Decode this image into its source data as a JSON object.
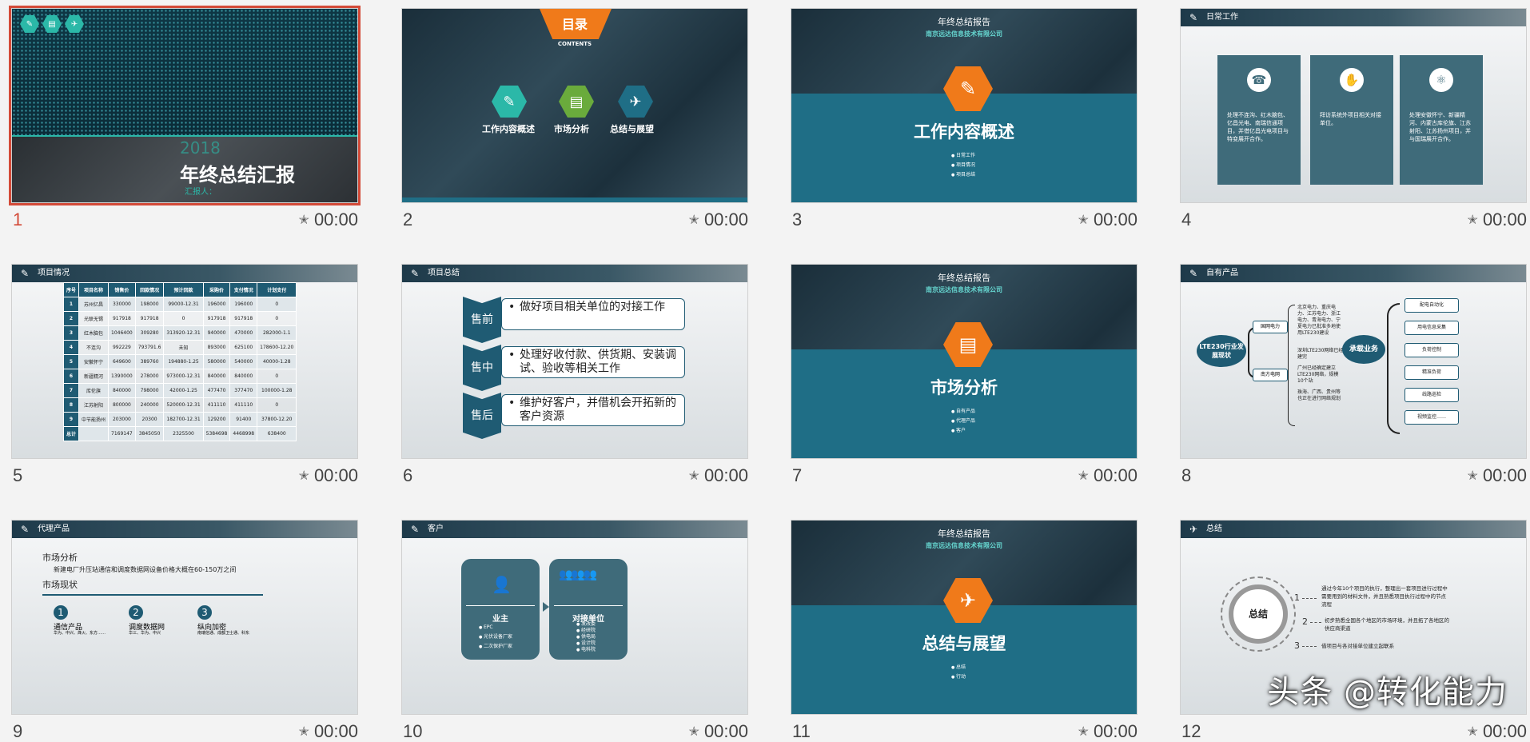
{
  "slides": [
    {
      "number": "1",
      "time": "00:00",
      "year": "2018",
      "title": "年终总结汇报",
      "reporter": "汇报人："
    },
    {
      "number": "2",
      "time": "00:00",
      "title": "目录",
      "subtitle": "CONTENTS",
      "items": [
        "工作内容概述",
        "市场分析",
        "总结与展望"
      ]
    },
    {
      "number": "3",
      "time": "00:00",
      "report": "年终总结报告",
      "company": "南京远达信息技术有限公司",
      "title": "工作内容概述",
      "bullets": [
        "日常工作",
        "项目情况",
        "项目总结"
      ]
    },
    {
      "number": "4",
      "time": "00:00",
      "header": "日常工作",
      "cards": [
        "处理不连沟、红木脑包、亿昌光电、南瑞信通项目，并借亿昌光电项目与特变展开合作。",
        "拜访系统外项目相关对接单位。",
        "处理安徽怀宁、新疆精河、内蒙古库伦旗、江苏射阳、江苏扬州项目，并与国瑞展开合作。"
      ]
    },
    {
      "number": "5",
      "time": "00:00",
      "header": "项目情况",
      "table_header": [
        "序号",
        "项目名称",
        "销售价",
        "回款情况",
        "预计回款",
        "采购价",
        "支付情况",
        "计划支付"
      ],
      "rows": [
        [
          "1",
          "苏州亿昌",
          "330000",
          "198000",
          "99000-12.31",
          "196000",
          "196000",
          "0"
        ],
        [
          "2",
          "光联无锡",
          "917918",
          "917918",
          "0",
          "917918",
          "917918",
          "0"
        ],
        [
          "3",
          "红木脑包",
          "1046400",
          "309280",
          "313920-12.31",
          "940000",
          "470000",
          "282000-1.1"
        ],
        [
          "4",
          "不连沟",
          "992229",
          "793791.6",
          "未知",
          "893000",
          "625100",
          "178600-12.20"
        ],
        [
          "5",
          "安徽怀宁",
          "649600",
          "389760",
          "194880-1.25",
          "580000",
          "540000",
          "40000-1.28"
        ],
        [
          "6",
          "新疆精河",
          "1390000",
          "278000",
          "973000-12.31",
          "840000",
          "840000",
          "0"
        ],
        [
          "7",
          "库伦旗",
          "840000",
          "798000",
          "42000-1.25",
          "477470",
          "377470",
          "100000-1.28"
        ],
        [
          "8",
          "江苏射阳",
          "800000",
          "240000",
          "520000-12.31",
          "411110",
          "411110",
          "0"
        ],
        [
          "9",
          "中节能扬州",
          "203000",
          "20300",
          "182700-12.31",
          "129200",
          "91400",
          "37800-12.20"
        ]
      ],
      "total": [
        "总计",
        "",
        "7169147",
        "3845050",
        "2325500",
        "5384698",
        "4468998",
        "638400"
      ]
    },
    {
      "number": "6",
      "time": "00:00",
      "header": "项目总结",
      "steps": [
        {
          "label": "售前",
          "text": "做好项目相关单位的对接工作"
        },
        {
          "label": "售中",
          "text": "处理好收付款、供货期、安装调试、验收等相关工作"
        },
        {
          "label": "售后",
          "text": "维护好客户，并借机会开拓新的客户资源"
        }
      ]
    },
    {
      "number": "7",
      "time": "00:00",
      "report": "年终总结报告",
      "company": "南京远达信息技术有限公司",
      "title": "市场分析",
      "bullets": [
        "自有产品",
        "代理产品",
        "客户"
      ]
    },
    {
      "number": "8",
      "time": "00:00",
      "header": "自有产品",
      "left": "LTE230行业发展现状",
      "b1": "国网电力",
      "b2": "南方电网",
      "t1": "北京电力、重庆电力、江苏电力、浙江电力、青海电力、宁夏电力已批准多地使用LTE230建设",
      "t2": "深圳LTE230网络已经建完",
      "t3": "广州已经确定建立LTE230网络，规模10个站",
      "t4": "珠海、广西、贵州等也正在进行网络规划",
      "right": "承载业务",
      "services": [
        "配电自动化",
        "用电信息采集",
        "负荷控制",
        "精准负荷",
        "线路巡检",
        "视频监控……"
      ]
    },
    {
      "number": "9",
      "time": "00:00",
      "header": "代理产品",
      "h1": "市场分析",
      "desc": "新建电厂升压站通信和调度数据网设备价格大概在60-150万之间",
      "h2": "市场现状",
      "steps": [
        {
          "n": "1",
          "label": "通信产品",
          "note": "华为、中兴、烽火、东方……"
        },
        {
          "n": "2",
          "label": "调度数据网",
          "note": "华三、华为、中兴"
        },
        {
          "n": "3",
          "label": "纵向加密",
          "note": "南瑞信通、成都卫士通、科东"
        }
      ]
    },
    {
      "number": "10",
      "time": "00:00",
      "header": "客户",
      "owner": "业主",
      "owner_items": [
        "EPC",
        "光伏设备厂家",
        "二次保护厂家"
      ],
      "partner": "对接单位",
      "partner_items": [
        "发改委",
        "经研院",
        "供电局",
        "设计院",
        "电科院"
      ]
    },
    {
      "number": "11",
      "time": "00:00",
      "report": "年终总结报告",
      "company": "南京远达信息技术有限公司",
      "title": "总结与展望",
      "bullets": [
        "总结",
        "行动"
      ]
    },
    {
      "number": "12",
      "time": "00:00",
      "header": "总结",
      "circle": "总结",
      "points": [
        "通过今年10个项目的执行，整理出一套项目进行过程中需要用到的材料文件，并且熟悉项目执行过程中的节点流程",
        "初步熟悉全国各个地区的市场环境，并且拓了各地区的供应商渠道",
        "借项目与各对接单位建立起联系"
      ]
    }
  ],
  "watermark": "头条 @转化能力",
  "colors": {
    "selected": "#d34a38",
    "teal": "#1f5b73",
    "orange": "#f07a1a",
    "cyan": "#2bb8a8"
  }
}
